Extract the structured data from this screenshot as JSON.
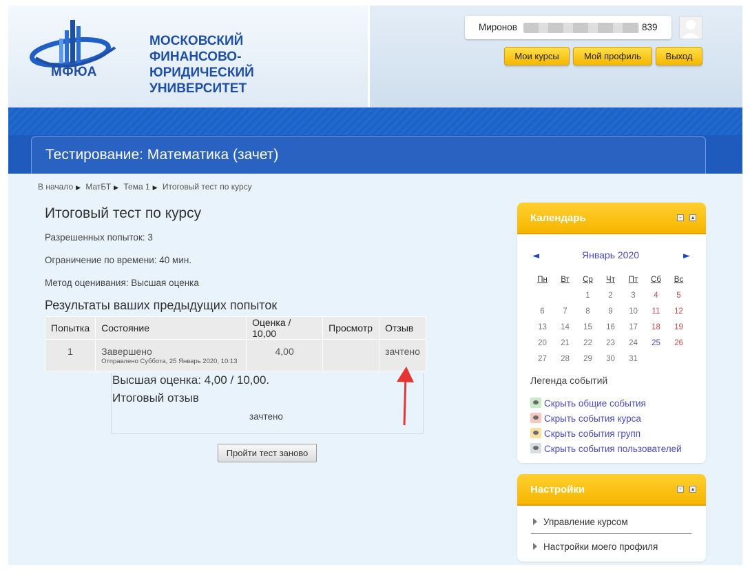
{
  "header": {
    "logo_text": "МФЮА",
    "university_name": [
      "МОСКОВСКИЙ",
      "ФИНАНСОВО-",
      "ЮРИДИЧЕСКИЙ",
      "УНИВЕРСИТЕТ"
    ],
    "user_name": "Миронов",
    "user_suffix": "839",
    "buttons": {
      "my_courses": "Мои курсы",
      "my_profile": "Мой профиль",
      "logout": "Выход"
    }
  },
  "page_title": "Тестирование: Математика (зачет)",
  "breadcrumb": [
    "В начало",
    "МатБТ",
    "Тема 1",
    "Итоговый тест по курсу"
  ],
  "main": {
    "title": "Итоговый тест по курсу",
    "attempts_allowed": "Разрешенных попыток: 3",
    "time_limit": "Ограничение по времени: 40 мин.",
    "grading_method": "Метод оценивания: Высшая оценка",
    "results_heading": "Результаты ваших предыдущих попыток",
    "table": {
      "headers": [
        "Попытка",
        "Состояние",
        "Оценка / 10,00",
        "Просмотр",
        "Отзыв"
      ],
      "rows": [
        {
          "attempt": "1",
          "state": "Завершено",
          "submitted": "Отправлено Суббота, 25 Январь 2020, 10:13",
          "grade": "4,00",
          "review": "",
          "feedback": "зачтено"
        }
      ]
    },
    "highest_grade": "Высшая оценка: 4,00 / 10,00.",
    "overall_feedback_title": "Итоговый отзыв",
    "overall_feedback": "зачтено",
    "retry_button": "Пройти тест заново"
  },
  "calendar": {
    "title": "Календарь",
    "prev": "◄",
    "next": "►",
    "month": "Январь 2020",
    "weekdays": [
      "Пн",
      "Вт",
      "Ср",
      "Чт",
      "Пт",
      "Сб",
      "Вс"
    ],
    "weeks": [
      [
        "",
        "",
        "1",
        "2",
        "3",
        "4",
        "5"
      ],
      [
        "6",
        "7",
        "8",
        "9",
        "10",
        "11",
        "12"
      ],
      [
        "13",
        "14",
        "15",
        "16",
        "17",
        "18",
        "19"
      ],
      [
        "20",
        "21",
        "22",
        "23",
        "24",
        "25",
        "26"
      ],
      [
        "27",
        "28",
        "29",
        "30",
        "31",
        "",
        ""
      ]
    ],
    "today": "25",
    "legend_title": "Легенда событий",
    "legend": [
      {
        "label": "Скрыть общие события",
        "color": "#c8ecc8"
      },
      {
        "label": "Скрыть события курса",
        "color": "#f6c8c0"
      },
      {
        "label": "Скрыть события групп",
        "color": "#f9e0a0"
      },
      {
        "label": "Скрыть события пользователей",
        "color": "#d8dde2"
      }
    ]
  },
  "settings": {
    "title": "Настройки",
    "items": [
      "Управление курсом",
      "Настройки моего профиля"
    ]
  },
  "colors": {
    "brand_blue": "#1f4fa3",
    "band_blue": "#1e5bbd",
    "accent_yellow": "#f7b600",
    "annotation_arrow": "#e53530"
  }
}
